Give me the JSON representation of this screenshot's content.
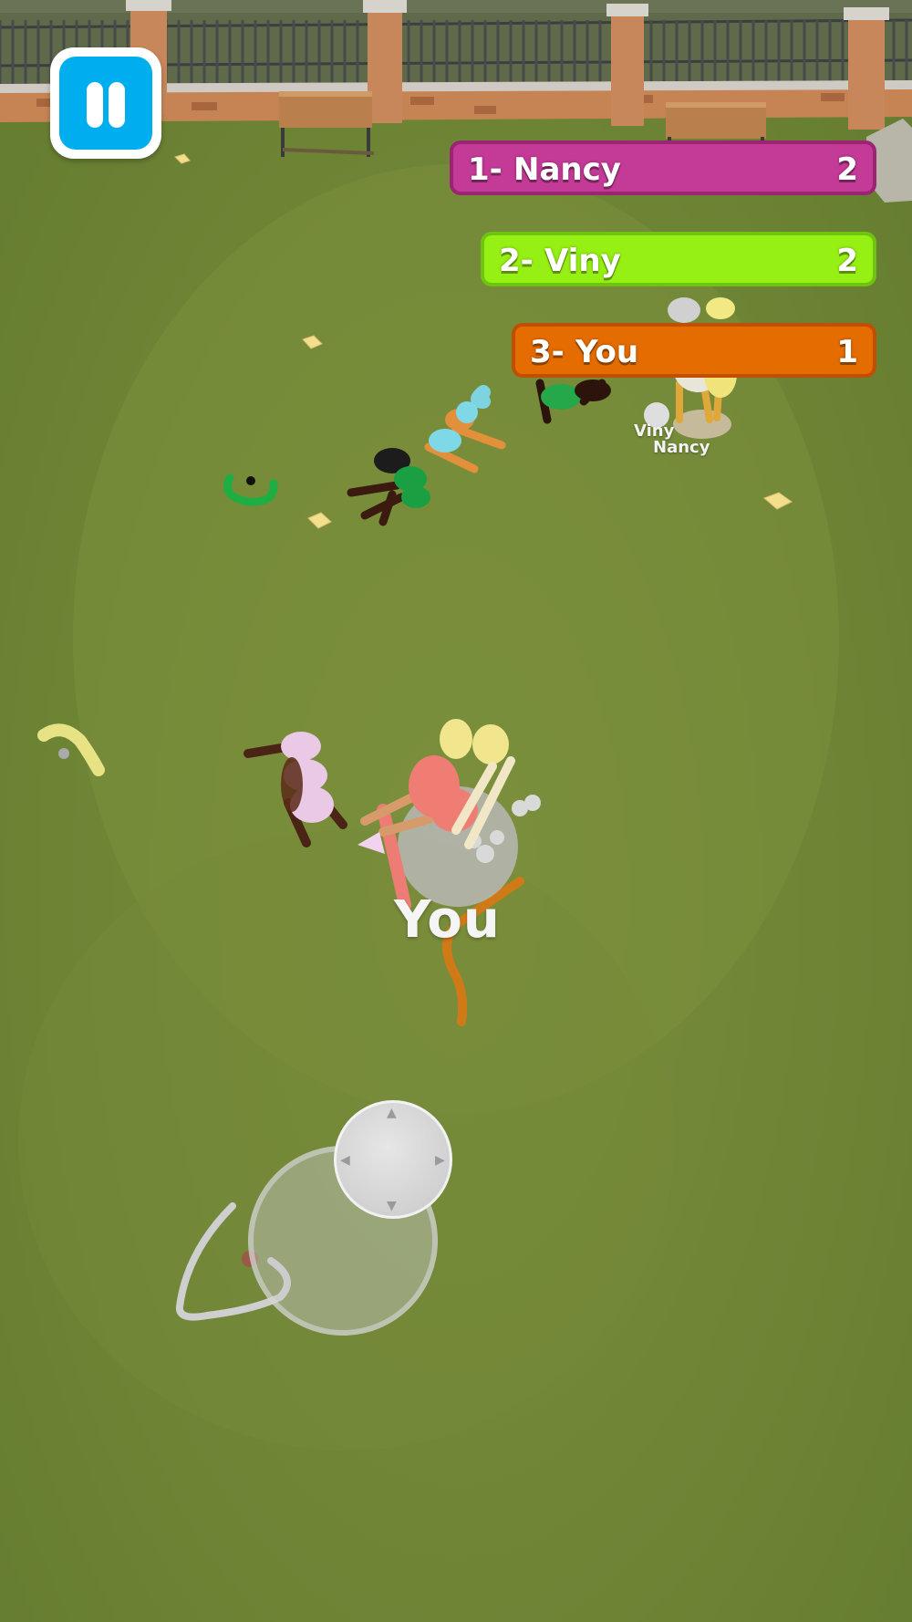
{
  "leaderboard": [
    {
      "rank": "1-",
      "name": "Nancy",
      "score": "2",
      "color": "#c43a97"
    },
    {
      "rank": "2-",
      "name": "Viny",
      "score": "2",
      "color": "#97f013"
    },
    {
      "rank": "3-",
      "name": "You",
      "score": "1",
      "color": "#e46c00"
    }
  ],
  "labels": {
    "player": "You",
    "opponent_1": "Viny",
    "opponent_2": "Nancy"
  },
  "colors": {
    "grass": "#6f8536",
    "pause": "#00aeef"
  },
  "icons": {
    "pause": "pause-icon",
    "joystick": "joystick-icon"
  }
}
